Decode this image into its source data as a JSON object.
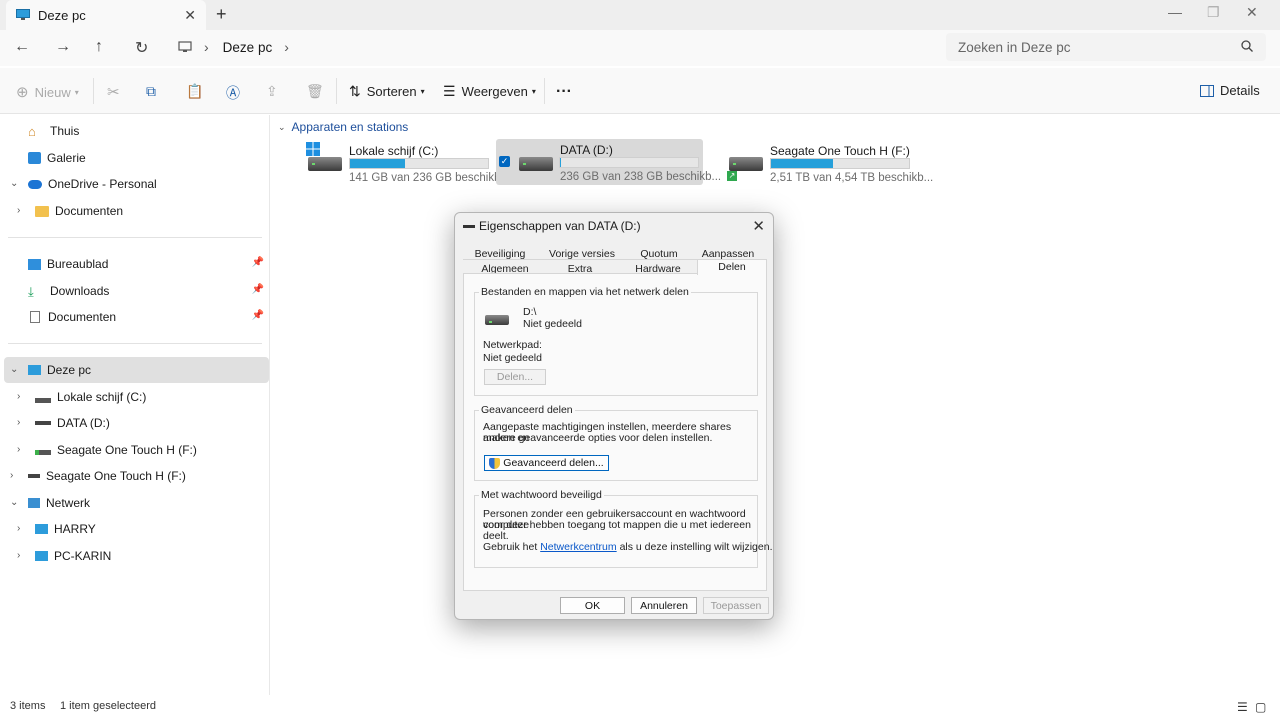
{
  "window": {
    "tab_title": "Deze pc",
    "new_tab": "+"
  },
  "address": {
    "crumb": "Deze pc",
    "search_placeholder": "Zoeken in Deze pc"
  },
  "toolbar": {
    "new_label": "Nieuw",
    "sort_label": "Sorteren",
    "view_label": "Weergeven",
    "more_label": "···",
    "details_label": "Details"
  },
  "sidebar": {
    "home": "Thuis",
    "gallery": "Galerie",
    "onedrive": "OneDrive - Personal",
    "onedrive_documents": "Documenten",
    "desktop": "Bureaublad",
    "downloads": "Downloads",
    "documents": "Documenten",
    "this_pc": "Deze pc",
    "drive_c": "Lokale schijf (C:)",
    "drive_d": "DATA (D:)",
    "drive_f_sub": "Seagate One Touch H (F:)",
    "drive_f": "Seagate One Touch H (F:)",
    "network": "Netwerk",
    "harry": "HARRY",
    "pc_karin": "PC-KARIN"
  },
  "main": {
    "group_header": "Apparaten en stations",
    "drives": [
      {
        "name": "Lokale schijf (C:)",
        "size": "141 GB van 236 GB beschikb...",
        "used_fraction": 0.4
      },
      {
        "name": "DATA (D:)",
        "size": "236 GB van 238 GB beschikb...",
        "used_fraction": 0.01
      },
      {
        "name": "Seagate One Touch H (F:)",
        "size": "2,51 TB van 4,54 TB beschikb...",
        "used_fraction": 0.45
      }
    ]
  },
  "dialog": {
    "title": "Eigenschappen van DATA (D:)",
    "tabs_row1": [
      "Beveiliging",
      "Vorige versies",
      "Quotum",
      "Aanpassen"
    ],
    "tabs_row2": [
      "Algemeen",
      "Extra",
      "Hardware",
      "Delen"
    ],
    "section1_legend": "Bestanden en mappen via het netwerk delen",
    "drive_path": "D:\\",
    "share_state": "Niet gedeeld",
    "network_path_label": "Netwerkpad:",
    "network_path_value": "Niet gedeeld",
    "share_button": "Delen...",
    "section2_legend": "Geavanceerd delen",
    "section2_text1": "Aangepaste machtigingen instellen, meerdere shares maken en",
    "section2_text2": "andere geavanceerde opties voor delen instellen.",
    "advanced_button": "Geavanceerd delen...",
    "section3_legend": "Met wachtwoord beveiligd",
    "section3_text1": "Personen zonder een gebruikersaccount en wachtwoord voor deze",
    "section3_text2": "computer hebben toegang tot mappen die u met iedereen deelt.",
    "section3_pre": "Gebruik het",
    "section3_link": "Netwerkcentrum",
    "section3_post": "als u deze instelling wilt wijzigen.",
    "ok": "OK",
    "cancel": "Annuleren",
    "apply": "Toepassen"
  },
  "status": {
    "items": "3 items",
    "selected": "1 item geselecteerd"
  }
}
